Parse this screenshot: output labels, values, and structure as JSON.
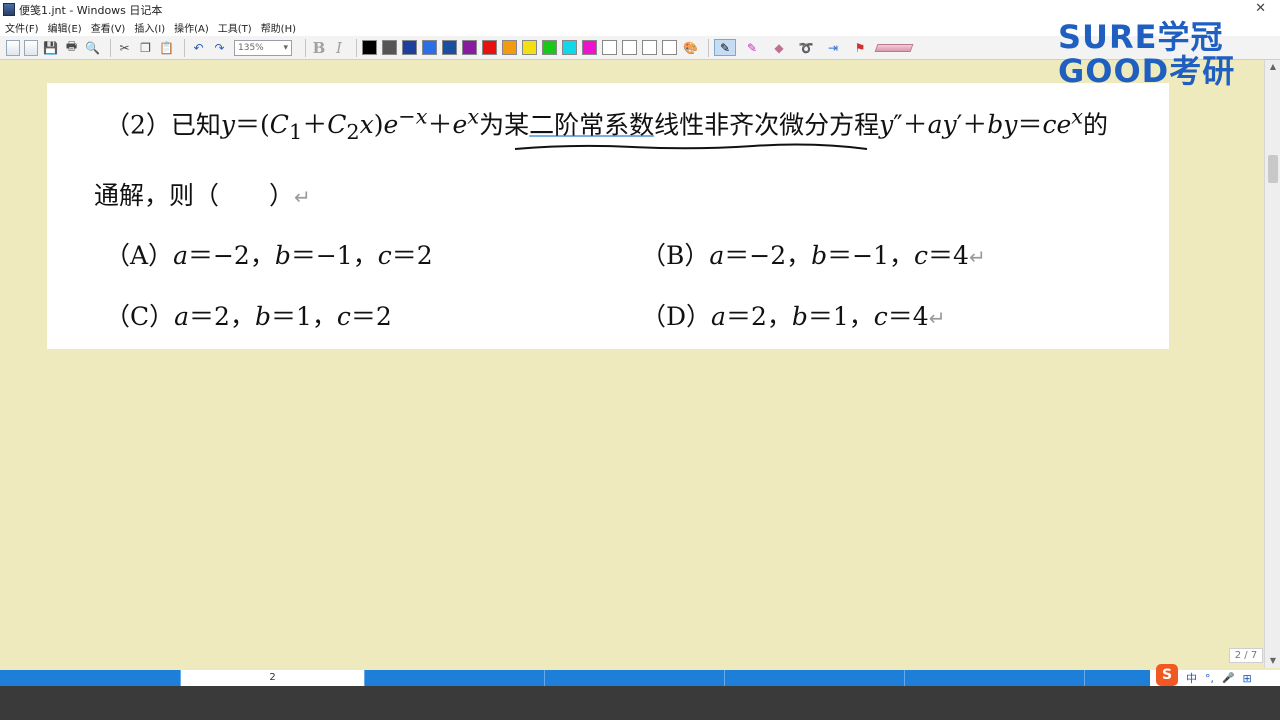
{
  "window": {
    "title": "便笺1.jnt - Windows 日记本"
  },
  "menu": [
    "文件(F)",
    "编辑(E)",
    "查看(V)",
    "插入(I)",
    "操作(A)",
    "工具(T)",
    "帮助(H)"
  ],
  "toolbar": {
    "zoom": "135%",
    "bold": "B",
    "italic": "I",
    "swatches": [
      "#000000",
      "#555555",
      "#1f3f9e",
      "#2a6fe8",
      "#1a4fa0",
      "#8a1aa0",
      "#e81010",
      "#f29a10",
      "#f2e010",
      "#1ac81a",
      "#10d8e8",
      "#f010d0",
      "#ffffff",
      "#ffffff",
      "#ffffff",
      "#ffffff"
    ]
  },
  "logo": {
    "line1": "SURE学冠",
    "line2": "GOOD考研"
  },
  "question": {
    "stem_lead": "（2）已知",
    "solution_html": "<i>y</i>＝(<i>C</i><sub>1</sub>＋<i>C</i><sub>2</sub><i>x</i>)<i>e</i><sup>−<i>x</i></sup>＋<i>e</i><sup><i>x</i></sup>",
    "stem_mid": "为某",
    "stem_underlined": "二阶常系数",
    "stem_mid2": "线性非齐次微分方程",
    "equation_html": "<i>y</i>″＋<i>ay</i>′＋<i>by</i>＝<i>ce</i><sup><i>x</i></sup>",
    "stem_end": "的",
    "line2": "通解，则（　　）",
    "return_mark": "↵",
    "options": [
      {
        "label": "（A）",
        "text_html": "<i>a</i>＝−2，<i>b</i>＝−1，<i>c</i>＝2"
      },
      {
        "label": "（B）",
        "text_html": "<i>a</i>＝−2，<i>b</i>＝−1，<i>c</i>＝4"
      },
      {
        "label": "（C）",
        "text_html": "<i>a</i>＝2，<i>b</i>＝1，<i>c</i>＝2"
      },
      {
        "label": "（D）",
        "text_html": "<i>a</i>＝2，<i>b</i>＝1，<i>c</i>＝4"
      }
    ]
  },
  "page_counter": "2 / 7",
  "page_tab": "2",
  "ime": {
    "logo": "S",
    "lang": "中",
    "punct": "°,",
    "mic": "🎤",
    "grid": "⊞"
  }
}
